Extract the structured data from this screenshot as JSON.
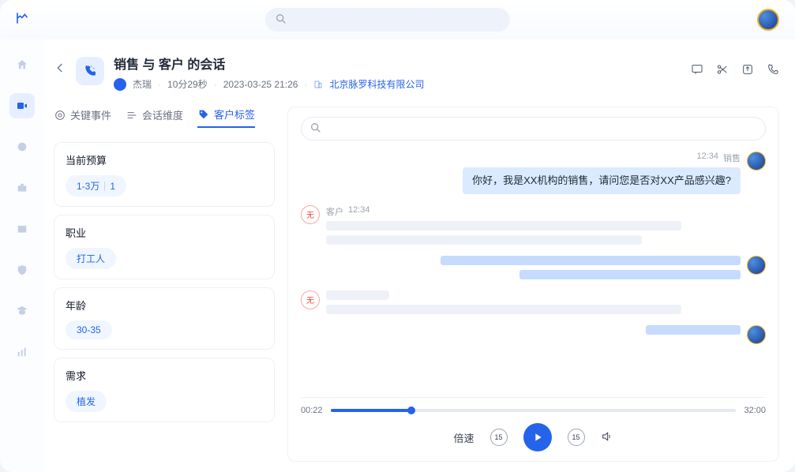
{
  "header": {
    "title": "销售 与 客户 的会话",
    "user_name": "杰瑞",
    "duration": "10分29秒",
    "datetime": "2023-03-25  21:26",
    "company": "北京脉罗科技有限公司"
  },
  "tabs": [
    {
      "id": "key",
      "label": "关键事件"
    },
    {
      "id": "dim",
      "label": "会话维度"
    },
    {
      "id": "tags",
      "label": "客户标签"
    }
  ],
  "active_tab": "tags",
  "tag_sections": [
    {
      "title": "当前预算",
      "chip": "1-3万",
      "count": "1"
    },
    {
      "title": "职业",
      "chip": "打工人"
    },
    {
      "title": "年龄",
      "chip": "30-35"
    },
    {
      "title": "需求",
      "chip": "植发"
    }
  ],
  "conversation": {
    "first_msg": {
      "time": "12:34",
      "role": "销售",
      "text": "你好，我是XX机构的销售，请问您是否对XX产品感兴趣?"
    },
    "customer_meta": {
      "badge": "无",
      "role": "客户",
      "time": "12:34"
    },
    "badge_none": "无"
  },
  "player": {
    "current_time": "00:22",
    "total_time": "32:00",
    "speed_label": "倍速",
    "skip_sec": "15"
  }
}
